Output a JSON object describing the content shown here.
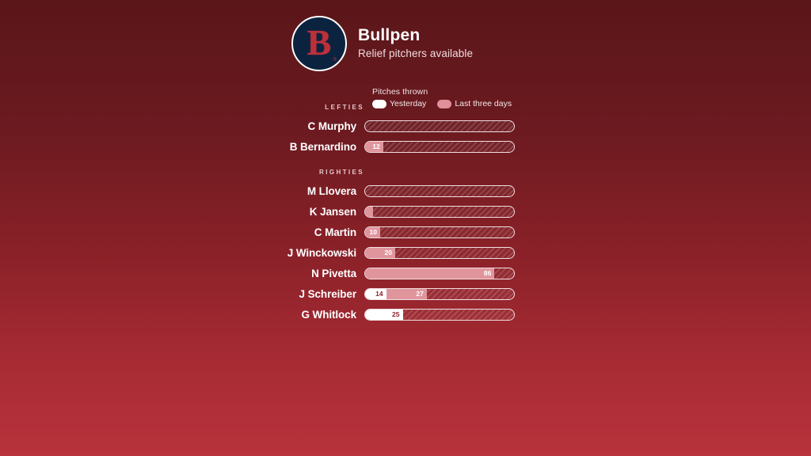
{
  "header": {
    "logo_icon": "red-sox-b-logo",
    "logo_letter": "B",
    "logo_tm": "®",
    "title": "Bullpen",
    "subtitle": "Relief pitchers available"
  },
  "legend": {
    "title": "Pitches thrown",
    "items": [
      {
        "label": "Yesterday",
        "color": "#ffffff",
        "key": "yesterday"
      },
      {
        "label": "Last three days",
        "color": "#e09098",
        "key": "last_three_days"
      }
    ]
  },
  "colors": {
    "yesterday": "#ffffff",
    "last_three_days": "#e0959c",
    "bar_outline": "#f2dfe1",
    "background_top": "#5a1619",
    "background_bottom": "#b8333c",
    "logo_navy": "#0c2340",
    "logo_red": "#bd3039"
  },
  "chart_data": {
    "type": "bar",
    "title": "Bullpen",
    "subtitle": "Relief pitchers available",
    "xlabel": "Pitches thrown",
    "ylabel": "",
    "xlim": [
      0,
      100
    ],
    "grid": false,
    "legend_position": "top",
    "stacked": true,
    "series": [
      {
        "name": "Yesterday",
        "color": "#ffffff"
      },
      {
        "name": "Last three days",
        "color": "#e0959c"
      }
    ],
    "groups": [
      {
        "label": "LEFTIES",
        "players": [
          {
            "name": "C Murphy",
            "yesterday": 0,
            "last_three_days": 0,
            "yesterday_label": "",
            "last_three_days_label": ""
          },
          {
            "name": "B Bernardino",
            "yesterday": 0,
            "last_three_days": 12,
            "yesterday_label": "",
            "last_three_days_label": "12"
          }
        ]
      },
      {
        "label": "RIGHTIES",
        "players": [
          {
            "name": "M Llovera",
            "yesterday": 0,
            "last_three_days": 0,
            "yesterday_label": "",
            "last_three_days_label": ""
          },
          {
            "name": "K Jansen",
            "yesterday": 0,
            "last_three_days": 5,
            "yesterday_label": "",
            "last_three_days_label": ""
          },
          {
            "name": "C Martin",
            "yesterday": 0,
            "last_three_days": 10,
            "yesterday_label": "",
            "last_three_days_label": "10"
          },
          {
            "name": "J Winckowski",
            "yesterday": 0,
            "last_three_days": 20,
            "yesterday_label": "",
            "last_three_days_label": "20"
          },
          {
            "name": "N Pivetta",
            "yesterday": 0,
            "last_three_days": 86,
            "yesterday_label": "",
            "last_three_days_label": "86"
          },
          {
            "name": "J Schreiber",
            "yesterday": 14,
            "last_three_days": 27,
            "yesterday_label": "14",
            "last_three_days_label": "27"
          },
          {
            "name": "G Whitlock",
            "yesterday": 25,
            "last_three_days": 0,
            "yesterday_label": "25",
            "last_three_days_label": ""
          }
        ]
      }
    ]
  }
}
